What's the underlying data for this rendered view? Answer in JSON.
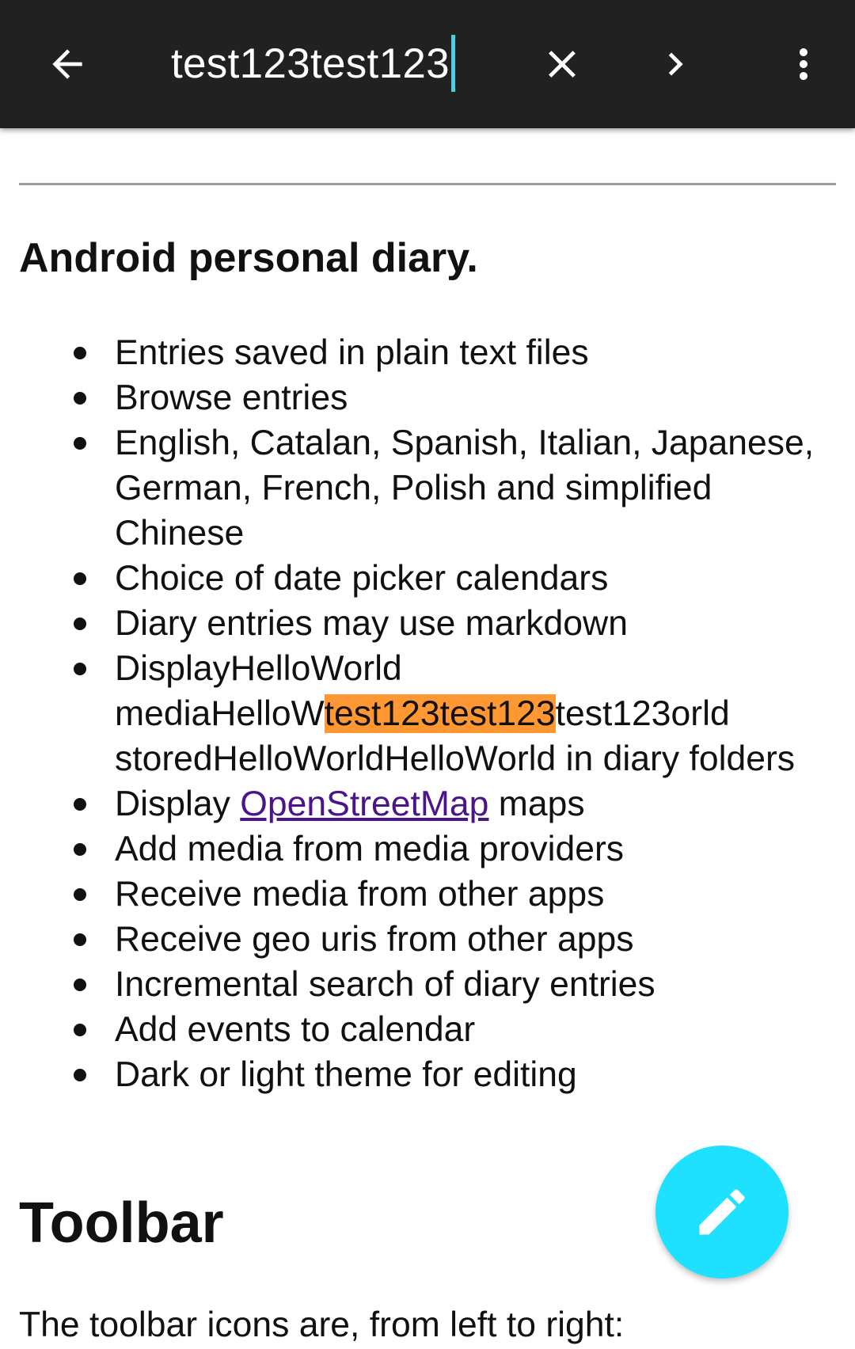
{
  "search_bar": {
    "query": "test123test123",
    "back_icon": "arrow-back-icon",
    "clear_icon": "close-icon",
    "next_icon": "chevron-right-icon",
    "more_icon": "more-vert-icon"
  },
  "document": {
    "section_heading": "Android personal diary.",
    "features": {
      "item0": "Entries saved in plain text files",
      "item1": "Browse entries",
      "item2": "English, Catalan, Spanish, Italian, Japanese, German, French, Polish and simplified Chinese",
      "item3": "Choice of date picker calendars",
      "item4": "Diary entries may use markdown",
      "item5_line1": "DisplayHelloWorld",
      "item5_pre": "mediaHelloW",
      "item5_match": "test123test123",
      "item5_post": "test123orld storedHelloWorldHelloWorld in diary folders",
      "item6_pre": "Display ",
      "item6_link": "OpenStreetMap",
      "item6_post": " maps",
      "item7": "Add media from media providers",
      "item8": "Receive media from other apps",
      "item9": "Receive geo uris from other apps",
      "item10": "Incremental search of diary entries",
      "item11": "Add events to calendar",
      "item12": "Dark or light theme for editing"
    },
    "toolbar_heading": "Toolbar",
    "toolbar_intro": "The toolbar icons are, from left to right:"
  },
  "fab": {
    "icon": "pencil-edit-icon",
    "color": "#1ee0ff"
  },
  "colors": {
    "toolbar_bg": "#212121",
    "highlight": "#ff9833",
    "link": "#4a148c",
    "caret": "#4dd0e1"
  }
}
